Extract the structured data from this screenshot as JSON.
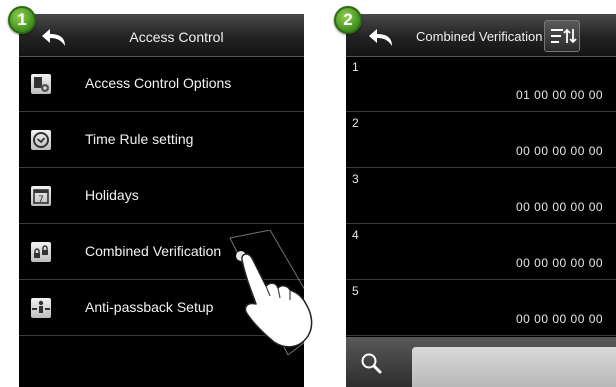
{
  "steps": {
    "step1": "1",
    "step2": "2"
  },
  "screen1": {
    "title": "Access Control",
    "menu": [
      {
        "label": "Access Control Options",
        "icon": "access-options-icon"
      },
      {
        "label": "Time Rule setting",
        "icon": "clock-icon"
      },
      {
        "label": "Holidays",
        "icon": "calendar-icon",
        "icon_text": "7"
      },
      {
        "label": "Combined Verification",
        "icon": "locks-icon"
      },
      {
        "label": "Anti-passback Setup",
        "icon": "anti-passback-icon"
      }
    ]
  },
  "screen2": {
    "title": "Combined Verification",
    "records": [
      {
        "num": "1",
        "value": "01 00 00 00 00"
      },
      {
        "num": "2",
        "value": "00 00 00 00 00"
      },
      {
        "num": "3",
        "value": "00 00 00 00 00"
      },
      {
        "num": "4",
        "value": "00 00 00 00 00"
      },
      {
        "num": "5",
        "value": "00 00 00 00 00"
      }
    ]
  },
  "icons": {
    "back": "back-arrow-icon",
    "sort": "sort-menu-icon",
    "search": "search-icon",
    "pointer": "tap-hand-icon"
  },
  "colors": {
    "step_badge": "#4fa22a",
    "screen_bg": "#000000",
    "text": "#f2f2f2"
  }
}
